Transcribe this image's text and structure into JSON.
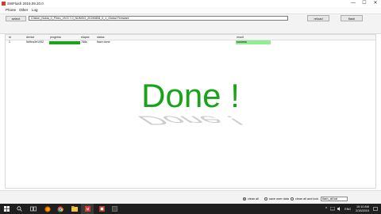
{
  "window": {
    "title": "SWFlash 2019.09.20.0",
    "controls": {
      "minimize": "—",
      "maximize": "☐",
      "close": "✕"
    }
  },
  "menu": [
    "Phone",
    "Other",
    "Log"
  ],
  "toolbar": {
    "select_label": "select",
    "path_value": "Chidori_Nokia_0_Pinec_VN 5 7.0_NUMGO_20190808_0_1_Global Firmware",
    "reload_label": "reload",
    "flash_label": "flash"
  },
  "table": {
    "headers": [
      "id",
      "device",
      "progress",
      "elapse",
      "status",
      "result"
    ],
    "rows": [
      {
        "id": "1",
        "device": "5d9ea3e1052",
        "progress": 1.0,
        "elapse": "768s",
        "status": "flash done",
        "result": "success"
      }
    ]
  },
  "overlay": {
    "text": "Done !",
    "color": "#18a318"
  },
  "bottom": {
    "options": [
      {
        "label": "clean all",
        "checked": true
      },
      {
        "label": "save user data",
        "checked": false
      },
      {
        "label": "clean all and lock",
        "checked": false
      }
    ],
    "script_select": "flash_all.bat"
  },
  "taskbar": {
    "time": "10:10 AM",
    "date": "2/15/2019"
  }
}
